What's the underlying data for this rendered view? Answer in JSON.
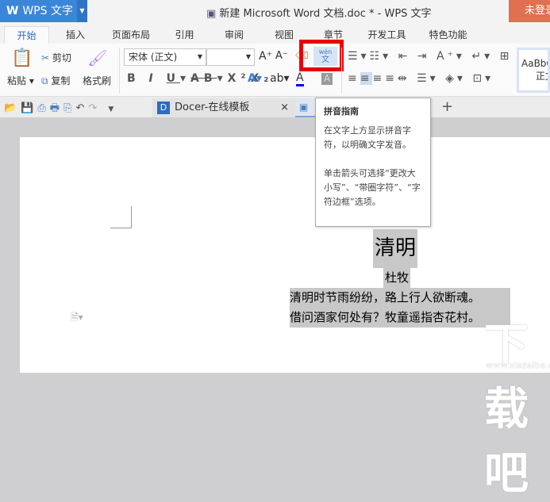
{
  "app": {
    "name": "WPS 文字",
    "title": "新建 Microsoft Word 文档.doc * - WPS 文字",
    "login": "未登录"
  },
  "tabs": [
    "开始",
    "插入",
    "页面布局",
    "引用",
    "审阅",
    "视图",
    "章节",
    "开发工具",
    "特色功能"
  ],
  "ribbon": {
    "paste": "粘贴",
    "cut": "剪切",
    "copy": "复制",
    "format_painter": "格式刷",
    "font": "宋体 (正文)",
    "font_size": "",
    "pinyin_top": "wén",
    "pinyin_bottom": "文",
    "style_preview": "AaBbC",
    "style_name": "正文"
  },
  "doc_tabs": {
    "docer": "Docer-在线模板",
    "add": "+"
  },
  "tooltip": {
    "title": "拼音指南",
    "line1": "在文字上方显示拼音字符，以明确文字发音。",
    "line2": "单击箭头可选择“更改大小写”、“带圈字符”、“字符边框”选项。"
  },
  "document": {
    "title": "清明",
    "author": "杜牧",
    "line1": "清明时节雨纷纷，路上行人欲断魂。",
    "line2": "借问酒家何处有？牧童遥指杏花村。"
  },
  "watermark": {
    "text": "下载吧",
    "url": "www.xiazaiba.com"
  }
}
